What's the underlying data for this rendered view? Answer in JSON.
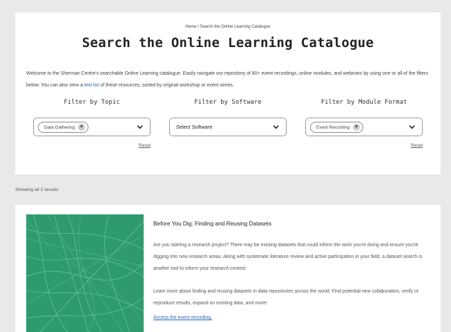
{
  "breadcrumb": "Home / Search the Online Learning Catalogue",
  "title": "Search the Online Learning Catalogue",
  "intro": {
    "text_before_link": "Welcome to the Sherman Centre's searchable Online Learning catalogue. Easily navigate our repository of 80+ event recordings, online modules, and webinars by using one or all of the filters below. You can also view a",
    "link": "text list",
    "text_after_link": "of these resources, sorted by original workshop or event series."
  },
  "filters": [
    {
      "title": "Filter by Topic",
      "chip": "Data Gathering",
      "placeholder": "",
      "reset": "Reset"
    },
    {
      "title": "Filter by Software",
      "chip": "",
      "placeholder": "Select Software",
      "reset": ""
    },
    {
      "title": "Filter by Module Format",
      "chip": "Event Recording",
      "placeholder": "",
      "reset": "Reset"
    }
  ],
  "results_count": "Showing all 2 results",
  "result": {
    "title": "Before You Dig: Finding and Reusing Datasets",
    "paragraph1": "Are you starting a research project? There may be existing datasets that could inform the work you're doing and ensure you're digging into new research areas. Along with systematic literature review and active participation in your field, a dataset search is another tool to inform your research context.",
    "paragraph2": "Learn more about finding and reusing datasets in data repositories across the world. Find potential new collaborators, verify or reproduce results, expand on existing data, and more!",
    "link": "Access the event recording."
  },
  "icons": {
    "chip_remove": "close-icon",
    "dropdown": "chevron-down-icon"
  },
  "colors": {
    "link": "#2a64b8",
    "thumbnail": "#2f9b6d"
  }
}
